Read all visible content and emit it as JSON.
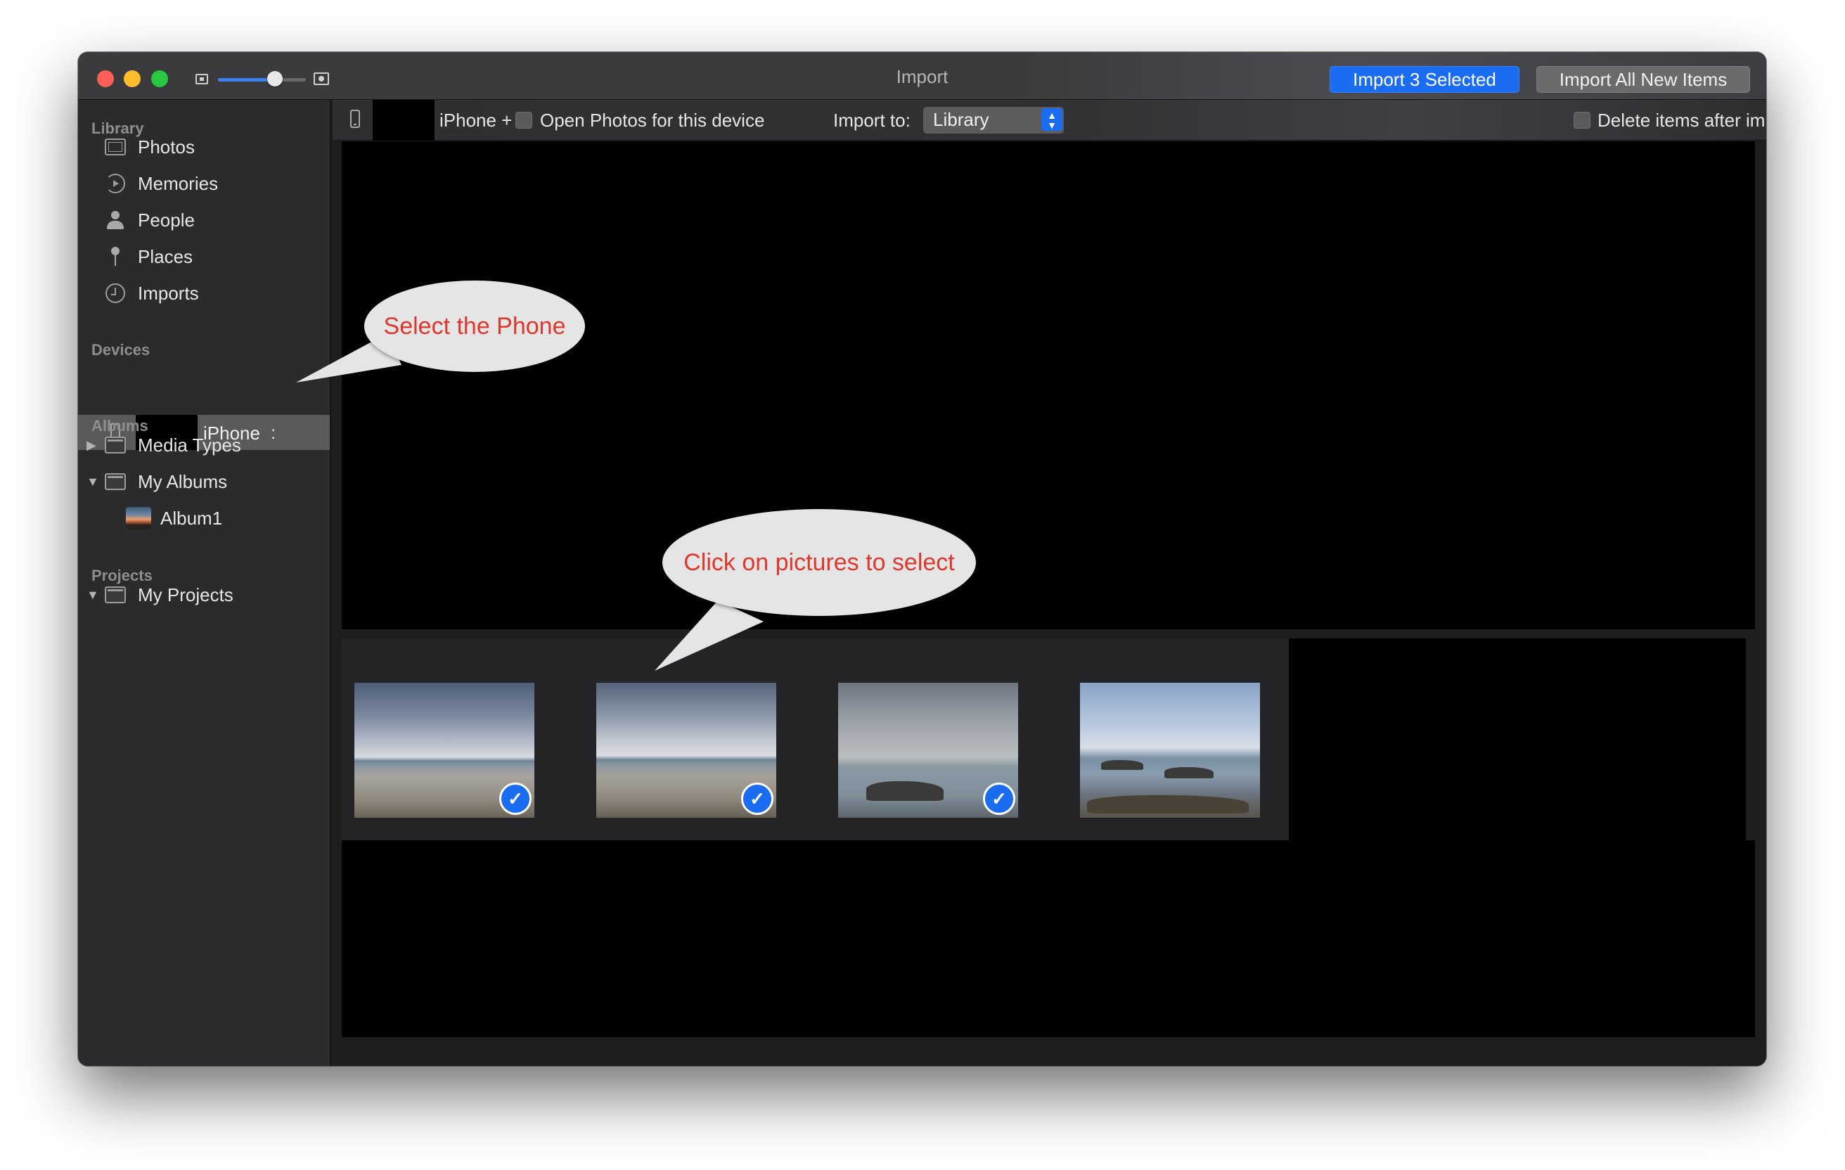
{
  "window": {
    "title": "Import",
    "import_selected_label": "Import 3 Selected",
    "import_all_label": "Import All New Items",
    "zoom_level": 0.65
  },
  "sidebar": {
    "sections": {
      "library": "Library",
      "devices": "Devices",
      "albums": "Albums",
      "projects": "Projects"
    },
    "library_items": [
      {
        "label": "Photos",
        "icon": "photos-icon"
      },
      {
        "label": "Memories",
        "icon": "memories-icon"
      },
      {
        "label": "People",
        "icon": "people-icon"
      },
      {
        "label": "Places",
        "icon": "places-icon"
      },
      {
        "label": "Imports",
        "icon": "imports-icon"
      }
    ],
    "device": {
      "label": "iPhone",
      "icon": "phone-icon"
    },
    "album_items": [
      {
        "label": "Media Types",
        "expanded": false
      },
      {
        "label": "My Albums",
        "expanded": true
      }
    ],
    "sub_album": {
      "label": "Album1"
    },
    "project_items": [
      {
        "label": "My Projects",
        "expanded": true
      }
    ]
  },
  "toolbar": {
    "device_label": "iPhone +",
    "open_photos_label": "Open Photos for this device",
    "open_photos_checked": false,
    "import_to_label": "Import to:",
    "import_to_value": "Library",
    "delete_after_label": "Delete items after import",
    "delete_after_checked": false
  },
  "thumbnails": [
    {
      "selected": true,
      "scene": "beach"
    },
    {
      "selected": true,
      "scene": "beach"
    },
    {
      "selected": true,
      "scene": "rock"
    },
    {
      "selected": false,
      "scene": "rocky-coast"
    }
  ],
  "annotations": {
    "phone_callout": "Select the Phone",
    "pictures_callout": "Click on pictures to select",
    "text_color": "#e0362c"
  },
  "colors": {
    "accent": "#1a6cf1",
    "close": "#fe5f57",
    "minimize": "#febc2e",
    "maximize": "#28c840"
  }
}
